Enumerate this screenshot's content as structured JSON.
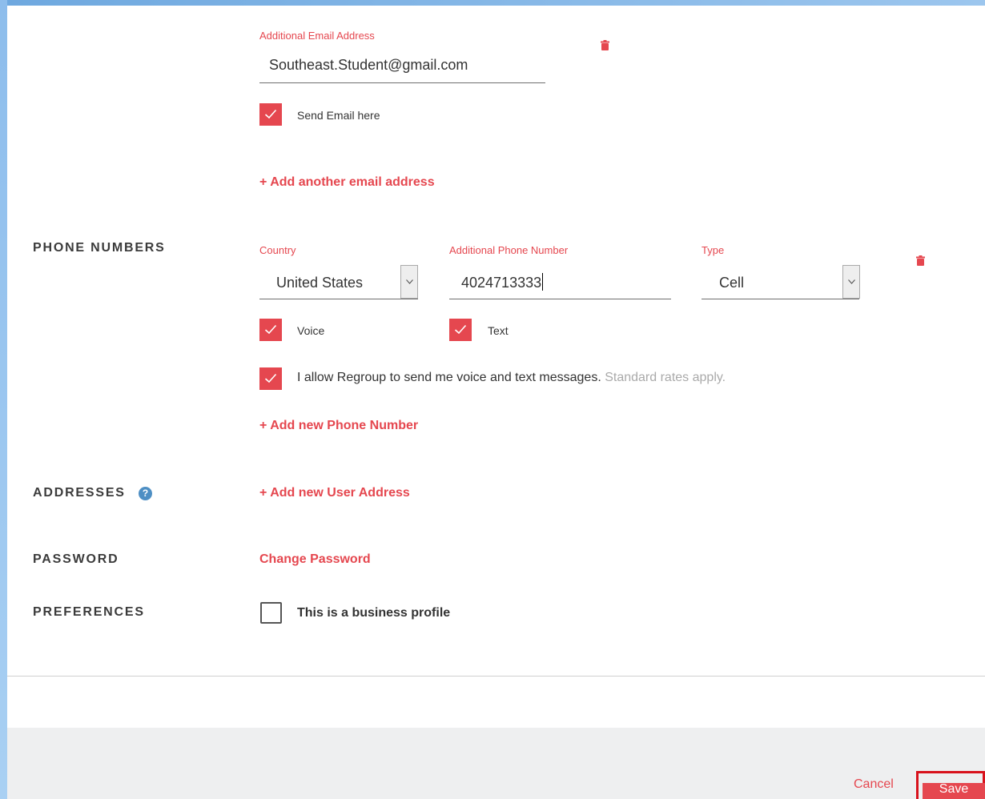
{
  "email": {
    "field_label": "Additional Email Address",
    "value": "Southeast.Student@gmail.com",
    "send_label": "Send Email here",
    "send_checked": true,
    "add_link": "+ Add another email address"
  },
  "phone": {
    "section_label": "PHONE NUMBERS",
    "country_label": "Country",
    "country_value": "United States",
    "number_label": "Additional Phone Number",
    "number_value": "4024713333",
    "type_label": "Type",
    "type_value": "Cell",
    "voice_label": "Voice",
    "voice_checked": true,
    "text_label": "Text",
    "text_checked": true,
    "consent_text": "I allow Regroup to send me voice and text messages.",
    "consent_note": "Standard rates apply.",
    "consent_checked": true,
    "add_link": "+ Add new Phone Number"
  },
  "addresses": {
    "section_label": "ADDRESSES",
    "help_icon": "question-circle-icon",
    "add_link": "+ Add new User Address"
  },
  "password": {
    "section_label": "PASSWORD",
    "change_link": "Change Password"
  },
  "preferences": {
    "section_label": "PREFERENCES",
    "business_label": "This is a business profile",
    "business_checked": false
  },
  "footer": {
    "cancel_label": "Cancel",
    "save_label": "Save"
  },
  "colors": {
    "accent": "#e5474f",
    "highlight": "#d8121c"
  }
}
